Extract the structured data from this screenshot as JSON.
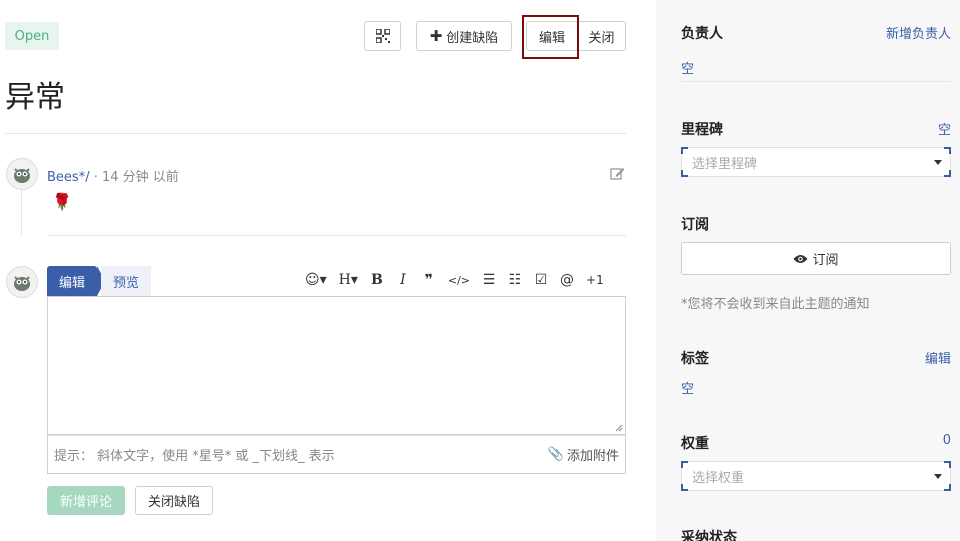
{
  "issue": {
    "status": "Open",
    "title": "异常"
  },
  "header_buttons": {
    "create_bug": "创建缺陷",
    "edit": "编辑",
    "close": "关闭"
  },
  "comment": {
    "author": "Bees*/",
    "separator": " · ",
    "time": "14 分钟 以前",
    "body": "🌹"
  },
  "editor": {
    "tab_edit": "编辑",
    "tab_preview": "预览",
    "toolbar": [
      "☺▾",
      "H▾",
      "B",
      "I",
      "❞",
      "</>",
      "☰",
      "☷",
      "☑",
      "@",
      "+1"
    ],
    "hint": "提示： 斜体文字，使用 *星号* 或 _下划线_ 表示",
    "attach": "添加附件",
    "submit": "新增评论",
    "close_issue": "关闭缺陷"
  },
  "sidebar": {
    "assignee_label": "负责人",
    "assignee_add": "新增负责人",
    "assignee_value": "空",
    "milestone_label": "里程碑",
    "milestone_value": "空",
    "milestone_placeholder": "选择里程碑",
    "subscribe_label": "订阅",
    "subscribe_button": "订阅",
    "subscribe_note": "*您将不会收到来自此主题的通知",
    "tags_label": "标签",
    "tags_edit": "编辑",
    "tags_value": "空",
    "weight_label": "权重",
    "weight_value": "0",
    "weight_placeholder": "选择权重",
    "adopt_label": "采纳状态"
  },
  "colors": {
    "accent": "#3b5ea8",
    "status_green": "#4caf7d",
    "highlight": "#7a0b0b"
  }
}
